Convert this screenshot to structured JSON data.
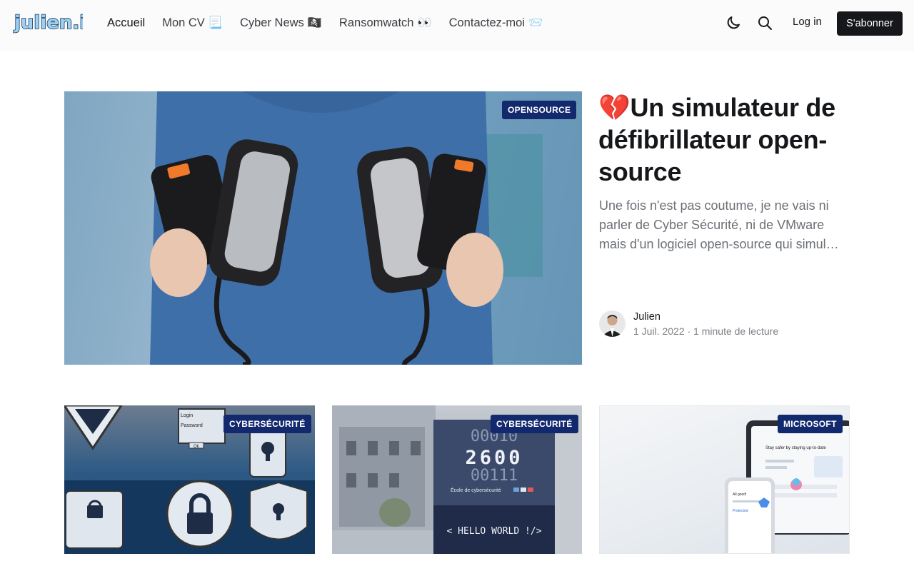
{
  "header": {
    "logo_text": "julien.io",
    "nav": [
      {
        "label": "Accueil"
      },
      {
        "label": "Mon CV 📃"
      },
      {
        "label": "Cyber News 🏴‍☠️"
      },
      {
        "label": "Ransomwatch 👀"
      },
      {
        "label": "Contactez-moi 📨"
      }
    ],
    "login_label": "Log in",
    "subscribe_label": "S'abonner",
    "icons": {
      "theme": "moon-icon",
      "search": "search-icon"
    }
  },
  "featured": {
    "tag": "OPENSOURCE",
    "title": "💔Un simulateur de défibrillateur open-source",
    "excerpt": "Une fois n'est pas coutume, je ne vais ni parler de Cyber Sécurité, ni de VMware mais d'un logiciel open-source qui simul…",
    "author": "Julien",
    "meta": "1 Juil. 2022 · 1 minute de lecture"
  },
  "cards": [
    {
      "tag": "CYBERSÉCURITÉ",
      "image_text": [
        "Login",
        "Password",
        "Ok"
      ]
    },
    {
      "tag": "CYBERSÉCURITÉ",
      "image_text": [
        "00010",
        "2600",
        "00111",
        "École de cybersécurité",
        "< HELLO WORLD !/>"
      ]
    },
    {
      "tag": "MICROSOFT",
      "image_text": [
        "Stay safer by staying up-to-date",
        "All good!",
        "Protected"
      ]
    }
  ],
  "colors": {
    "tag_bg": "#13296e",
    "accent": "#15171a",
    "header_bg": "#fbfbfb"
  }
}
